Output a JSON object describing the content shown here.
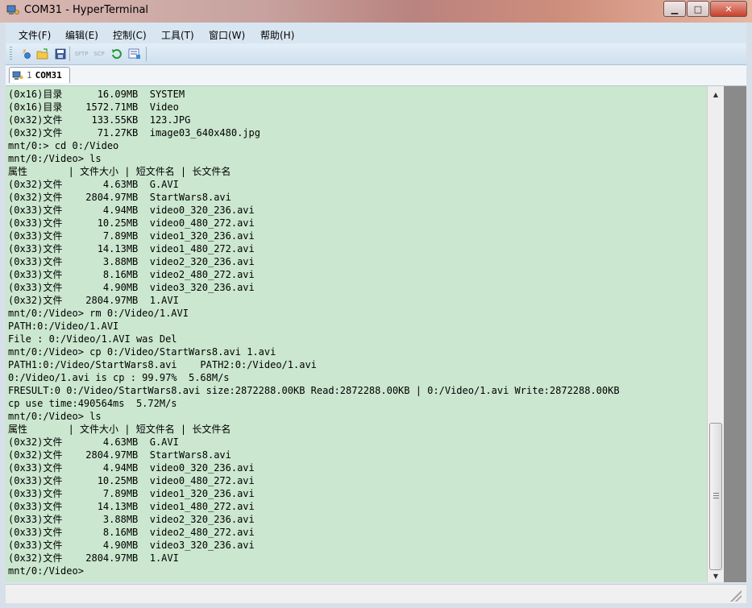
{
  "window": {
    "title": "COM31 - HyperTerminal",
    "minimize_glyph": "▁",
    "maximize_glyph": "□",
    "close_glyph": "✕"
  },
  "menu": [
    {
      "label": "文件(F)"
    },
    {
      "label": "编辑(E)"
    },
    {
      "label": "控制(C)"
    },
    {
      "label": "工具(T)"
    },
    {
      "label": "窗口(W)"
    },
    {
      "label": "帮助(H)"
    }
  ],
  "toolbar": {
    "icons": [
      "new-connection-icon",
      "open-folder-icon",
      "save-icon",
      "sftp-icon",
      "scp-icon",
      "reconnect-icon",
      "properties-icon"
    ],
    "sftp_label": "SFTP",
    "scp_label": "SCP"
  },
  "tab": {
    "number": "1",
    "label": "COM31"
  },
  "terminal": {
    "lines": [
      "(0x16)目录      16.09MB  SYSTEM",
      "(0x16)目录    1572.71MB  Video",
      "(0x32)文件     133.55KB  123.JPG",
      "(0x32)文件      71.27KB  image03_640x480.jpg",
      "mnt/0:> cd 0:/Video",
      "mnt/0:/Video> ls",
      "属性       | 文件大小 | 短文件名 | 长文件名",
      "(0x32)文件       4.63MB  G.AVI",
      "(0x32)文件    2804.97MB  StartWars8.avi",
      "(0x33)文件       4.94MB  video0_320_236.avi",
      "(0x33)文件      10.25MB  video0_480_272.avi",
      "(0x33)文件       7.89MB  video1_320_236.avi",
      "(0x33)文件      14.13MB  video1_480_272.avi",
      "(0x33)文件       3.88MB  video2_320_236.avi",
      "(0x33)文件       8.16MB  video2_480_272.avi",
      "(0x33)文件       4.90MB  video3_320_236.avi",
      "(0x32)文件    2804.97MB  1.AVI",
      "mnt/0:/Video> rm 0:/Video/1.AVI",
      "PATH:0:/Video/1.AVI",
      "File : 0:/Video/1.AVI was Del",
      "mnt/0:/Video> cp 0:/Video/StartWars8.avi 1.avi",
      "PATH1:0:/Video/StartWars8.avi    PATH2:0:/Video/1.avi",
      "0:/Video/1.avi is cp : 99.97%  5.68M/s",
      "FRESULT:0 0:/Video/StartWars8.avi size:2872288.00KB Read:2872288.00KB | 0:/Video/1.avi Write:2872288.00KB",
      "cp use time:490564ms  5.72M/s",
      "mnt/0:/Video> ls",
      "属性       | 文件大小 | 短文件名 | 长文件名",
      "(0x32)文件       4.63MB  G.AVI",
      "(0x32)文件    2804.97MB  StartWars8.avi",
      "(0x33)文件       4.94MB  video0_320_236.avi",
      "(0x33)文件      10.25MB  video0_480_272.avi",
      "(0x33)文件       7.89MB  video1_320_236.avi",
      "(0x33)文件      14.13MB  video1_480_272.avi",
      "(0x33)文件       3.88MB  video2_320_236.avi",
      "(0x33)文件       8.16MB  video2_480_272.avi",
      "(0x33)文件       4.90MB  video3_320_236.avi",
      "(0x32)文件    2804.97MB  1.AVI",
      "mnt/0:/Video>"
    ]
  },
  "colors": {
    "terminal_bg": "#cbe7cf",
    "menubar_bg": "#d8e6f1"
  }
}
